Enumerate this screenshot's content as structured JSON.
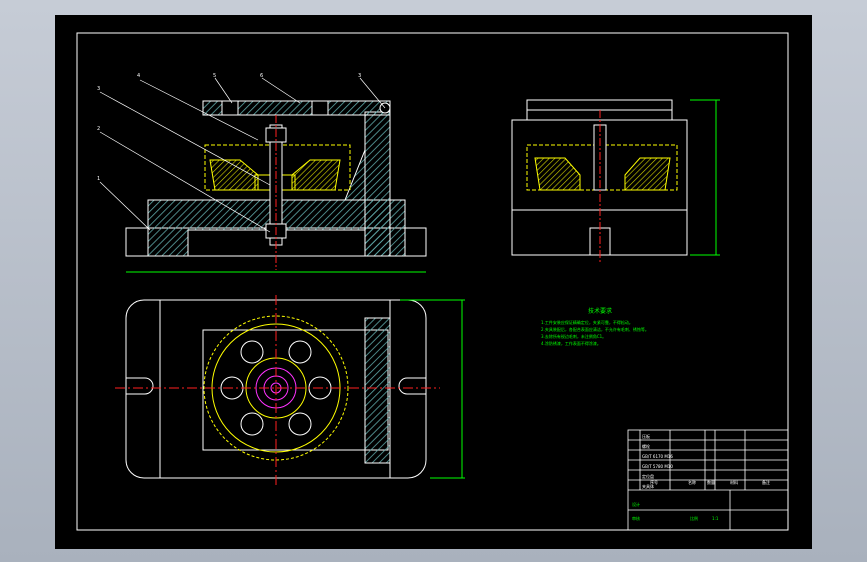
{
  "viewport": {
    "background": "#000000",
    "frame_color": "#ffffff"
  },
  "colors": {
    "outline": "#ffffff",
    "hatch": "#5fa8a8",
    "hidden": "#ffff00",
    "center": "#ff2020",
    "dimension": "#00ff00",
    "pointer": "#ffffff",
    "magenta": "#ff33ff"
  },
  "callouts": [
    "4",
    "5",
    "6",
    "3",
    "3",
    "2",
    "1"
  ],
  "notes": {
    "title": "技术要求",
    "lines": [
      "1.工件安装应保证精确定位，夹紧可靠，不得松动。",
      "2.夹具装配后，各配合表面应清洁，不允许有毛刺、锈蚀等。",
      "3.去除所有锐边毛刺，未注倒角C1。",
      "4.涂防锈漆，工作表面不得涂漆。"
    ]
  },
  "title_block": {
    "rows": [
      [
        "6",
        "压板",
        "1",
        "45"
      ],
      [
        "5",
        "螺栓",
        "1",
        "45"
      ],
      [
        "4",
        "GB/T 6170 M16",
        "2",
        "35"
      ],
      [
        "3",
        "GB/T 5780 M10",
        "1",
        "35"
      ],
      [
        "2",
        "定位盘",
        "1",
        "45"
      ],
      [
        "1",
        "夹具体",
        "1",
        "HT200"
      ]
    ],
    "header": [
      "序号",
      "名称",
      "数量",
      "材料",
      "备注"
    ],
    "bottom": [
      "设计",
      "审核",
      "比例",
      "1:1"
    ]
  }
}
